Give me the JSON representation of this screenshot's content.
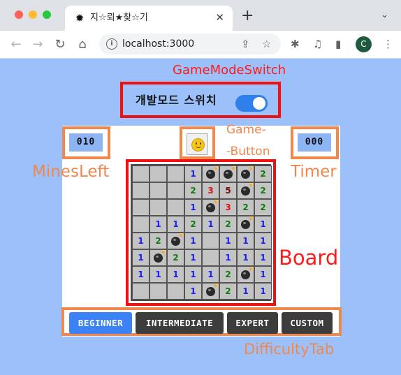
{
  "browser": {
    "tab_title": "지☆뢰★찾☆기",
    "tab_favicon": "✹",
    "tab_close": "✕",
    "new_tab": "+",
    "tab_menu": "⌄",
    "url": "localhost:3000",
    "profile_initial": "C",
    "icons": {
      "back": "←",
      "forward": "→",
      "reload": "↻",
      "home": "⌂",
      "info": "i",
      "share": "⇪",
      "bookmark": "☆",
      "extensions": "✱",
      "media": "♫",
      "sidepanel": "▮",
      "menu": "⋮"
    },
    "colors": {
      "close": "#ff5f57",
      "minimize": "#febc2e",
      "maximize": "#28c840"
    }
  },
  "annotations": {
    "game_mode_switch": "GameModeSwitch",
    "game_button_line1": "Game-",
    "game_button_line2": "-Button",
    "mines_left": "MinesLeft",
    "timer": "Timer",
    "board": "Board",
    "difficulty_tab": "DifficultyTab"
  },
  "mode_switch": {
    "label": "개발모드 스위치",
    "on": true
  },
  "mines_left_value": "010",
  "timer_value": "000",
  "board": {
    "rows": [
      [
        "",
        "",
        "",
        "1",
        "*",
        "*",
        "*",
        "2"
      ],
      [
        "",
        "",
        "",
        "2",
        "3",
        "5",
        "*",
        "2"
      ],
      [
        "",
        "",
        "",
        "1",
        "*",
        "3",
        "2",
        "2"
      ],
      [
        "",
        "1",
        "1",
        "2",
        "1",
        "2",
        "*",
        "1"
      ],
      [
        "1",
        "2",
        "*",
        "1",
        "",
        "1",
        "1",
        "1"
      ],
      [
        "1",
        "*",
        "2",
        "1",
        "",
        "1",
        "1",
        "1"
      ],
      [
        "1",
        "1",
        "1",
        "1",
        "1",
        "2",
        "*",
        "1"
      ],
      [
        "",
        "",
        "",
        "1",
        "*",
        "2",
        "1",
        "1"
      ]
    ],
    "number_colors": {
      "1": "#1a1aff",
      "2": "#0f7a0f",
      "3": "#e01010",
      "5": "#7a0a0a"
    }
  },
  "difficulty": {
    "tabs": [
      {
        "label": "BEGINNER",
        "active": true
      },
      {
        "label": "INTERMEDIATE",
        "active": false
      },
      {
        "label": "EXPERT",
        "active": false
      },
      {
        "label": "CUSTOM",
        "active": false
      }
    ],
    "active_color": "#3b82f6",
    "inactive_color": "#3c3c3c"
  }
}
